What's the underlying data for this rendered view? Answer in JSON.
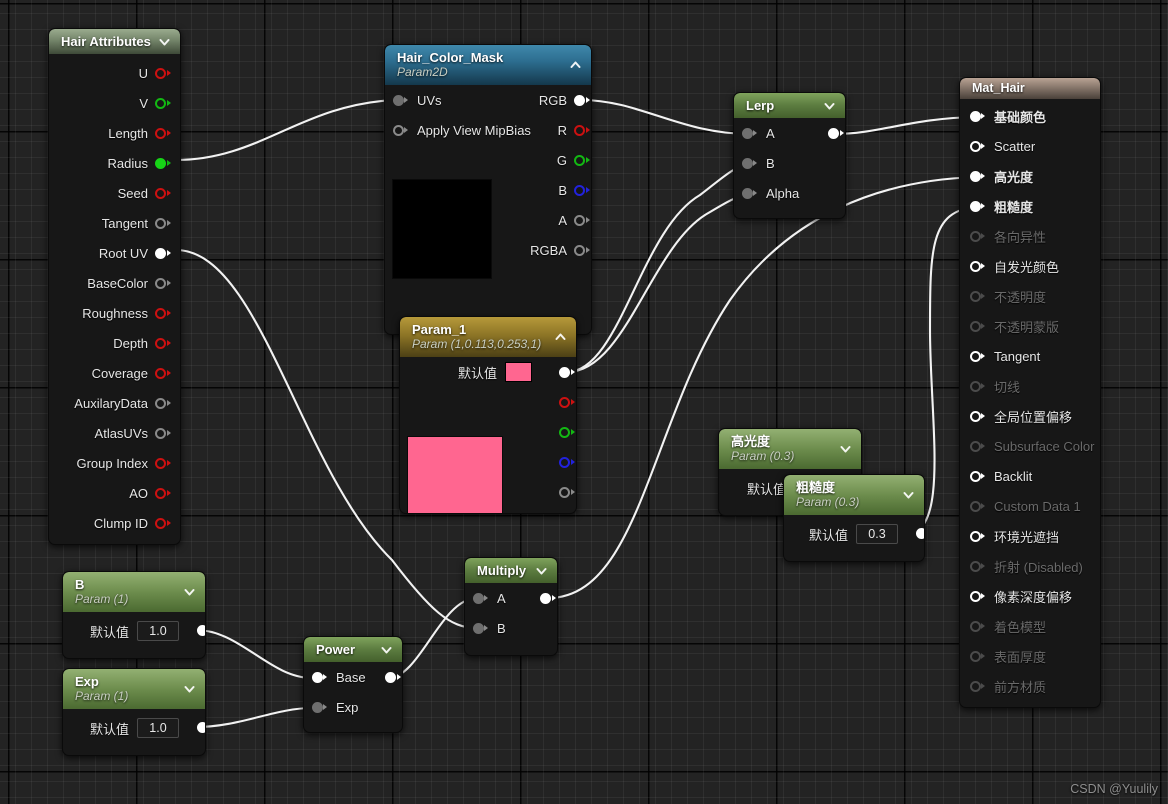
{
  "watermark": "CSDN @Yuulily",
  "nodes": {
    "hair_attributes": {
      "title": "Hair Attributes",
      "outputs": [
        {
          "label": "U",
          "pin": "red"
        },
        {
          "label": "V",
          "pin": "green"
        },
        {
          "label": "Length",
          "pin": "red"
        },
        {
          "label": "Radius",
          "pin": "green-filled"
        },
        {
          "label": "Seed",
          "pin": "red"
        },
        {
          "label": "Tangent",
          "pin": "grey"
        },
        {
          "label": "Root UV",
          "pin": "white-filled"
        },
        {
          "label": "BaseColor",
          "pin": "grey"
        },
        {
          "label": "Roughness",
          "pin": "red"
        },
        {
          "label": "Depth",
          "pin": "red"
        },
        {
          "label": "Coverage",
          "pin": "red"
        },
        {
          "label": "AuxilaryData",
          "pin": "grey"
        },
        {
          "label": "AtlasUVs",
          "pin": "grey"
        },
        {
          "label": "Group Index",
          "pin": "red"
        },
        {
          "label": "AO",
          "pin": "red"
        },
        {
          "label": "Clump ID",
          "pin": "red"
        }
      ]
    },
    "hair_color_mask": {
      "title": "Hair_Color_Mask",
      "subtitle": "Param2D",
      "inputs": [
        {
          "label": "UVs",
          "pin": "grey-filled"
        },
        {
          "label": "Apply View MipBias",
          "pin": "grey"
        }
      ],
      "outputs": [
        {
          "label": "RGB",
          "pin": "white-filled"
        },
        {
          "label": "R",
          "pin": "red"
        },
        {
          "label": "G",
          "pin": "green"
        },
        {
          "label": "B",
          "pin": "blue"
        },
        {
          "label": "A",
          "pin": "grey"
        },
        {
          "label": "RGBA",
          "pin": "grey"
        }
      ],
      "preview_color": "#000000"
    },
    "param_1": {
      "title": "Param_1",
      "subtitle": "Param (1,0.113,0.253,1)",
      "default_label": "默认值",
      "swatch_color": "#ff6690",
      "preview_color": "#ff6690",
      "outputs": [
        {
          "label": "",
          "pin": "white-filled"
        },
        {
          "label": "",
          "pin": "red"
        },
        {
          "label": "",
          "pin": "green"
        },
        {
          "label": "",
          "pin": "blue"
        },
        {
          "label": "",
          "pin": "grey"
        }
      ]
    },
    "lerp": {
      "title": "Lerp",
      "inputs": [
        {
          "label": "A",
          "pin": "grey-filled"
        },
        {
          "label": "B",
          "pin": "grey-filled"
        },
        {
          "label": "Alpha",
          "pin": "grey-filled"
        }
      ],
      "outputs": [
        {
          "label": "",
          "pin": "white-filled"
        }
      ]
    },
    "specular_param": {
      "title": "高光度",
      "subtitle": "Param (0.3)",
      "default_label": "默认值",
      "value": "0.3"
    },
    "roughness_param": {
      "title": "粗糙度",
      "subtitle": "Param (0.3)",
      "default_label": "默认值",
      "value": "0.3"
    },
    "b_param": {
      "title": "B",
      "subtitle": "Param (1)",
      "default_label": "默认值",
      "value": "1.0"
    },
    "exp_param": {
      "title": "Exp",
      "subtitle": "Param (1)",
      "default_label": "默认值",
      "value": "1.0"
    },
    "power": {
      "title": "Power",
      "inputs": [
        {
          "label": "Base",
          "pin": "white-filled"
        },
        {
          "label": "Exp",
          "pin": "grey-filled"
        }
      ],
      "outputs": [
        {
          "label": "",
          "pin": "white-filled"
        }
      ]
    },
    "multiply": {
      "title": "Multiply",
      "inputs": [
        {
          "label": "A",
          "pin": "grey-filled"
        },
        {
          "label": "B",
          "pin": "grey-filled"
        }
      ],
      "outputs": [
        {
          "label": "",
          "pin": "white-filled"
        }
      ]
    },
    "mat_hair": {
      "title": "Mat_Hair",
      "inputs": [
        {
          "label": "基础颜色",
          "pin": "white-filled",
          "state": "connected"
        },
        {
          "label": "Scatter",
          "pin": "white",
          "state": "enabled"
        },
        {
          "label": "高光度",
          "pin": "white-filled",
          "state": "connected"
        },
        {
          "label": "粗糙度",
          "pin": "white-filled",
          "state": "connected"
        },
        {
          "label": "各向异性",
          "pin": "dim",
          "state": "disabled"
        },
        {
          "label": "自发光颜色",
          "pin": "white",
          "state": "enabled"
        },
        {
          "label": "不透明度",
          "pin": "dim",
          "state": "disabled"
        },
        {
          "label": "不透明蒙版",
          "pin": "dim",
          "state": "disabled"
        },
        {
          "label": "Tangent",
          "pin": "white",
          "state": "enabled"
        },
        {
          "label": "切线",
          "pin": "dim",
          "state": "disabled"
        },
        {
          "label": "全局位置偏移",
          "pin": "white",
          "state": "enabled"
        },
        {
          "label": "Subsurface Color",
          "pin": "dim",
          "state": "disabled"
        },
        {
          "label": "Backlit",
          "pin": "white",
          "state": "enabled"
        },
        {
          "label": "Custom Data 1",
          "pin": "dim",
          "state": "disabled"
        },
        {
          "label": "环境光遮挡",
          "pin": "white",
          "state": "enabled"
        },
        {
          "label": "折射 (Disabled)",
          "pin": "dim",
          "state": "disabled"
        },
        {
          "label": "像素深度偏移",
          "pin": "white",
          "state": "enabled"
        },
        {
          "label": "着色模型",
          "pin": "dim",
          "state": "disabled"
        },
        {
          "label": "表面厚度",
          "pin": "dim",
          "state": "disabled"
        },
        {
          "label": "前方材质",
          "pin": "dim",
          "state": "disabled"
        }
      ]
    }
  }
}
